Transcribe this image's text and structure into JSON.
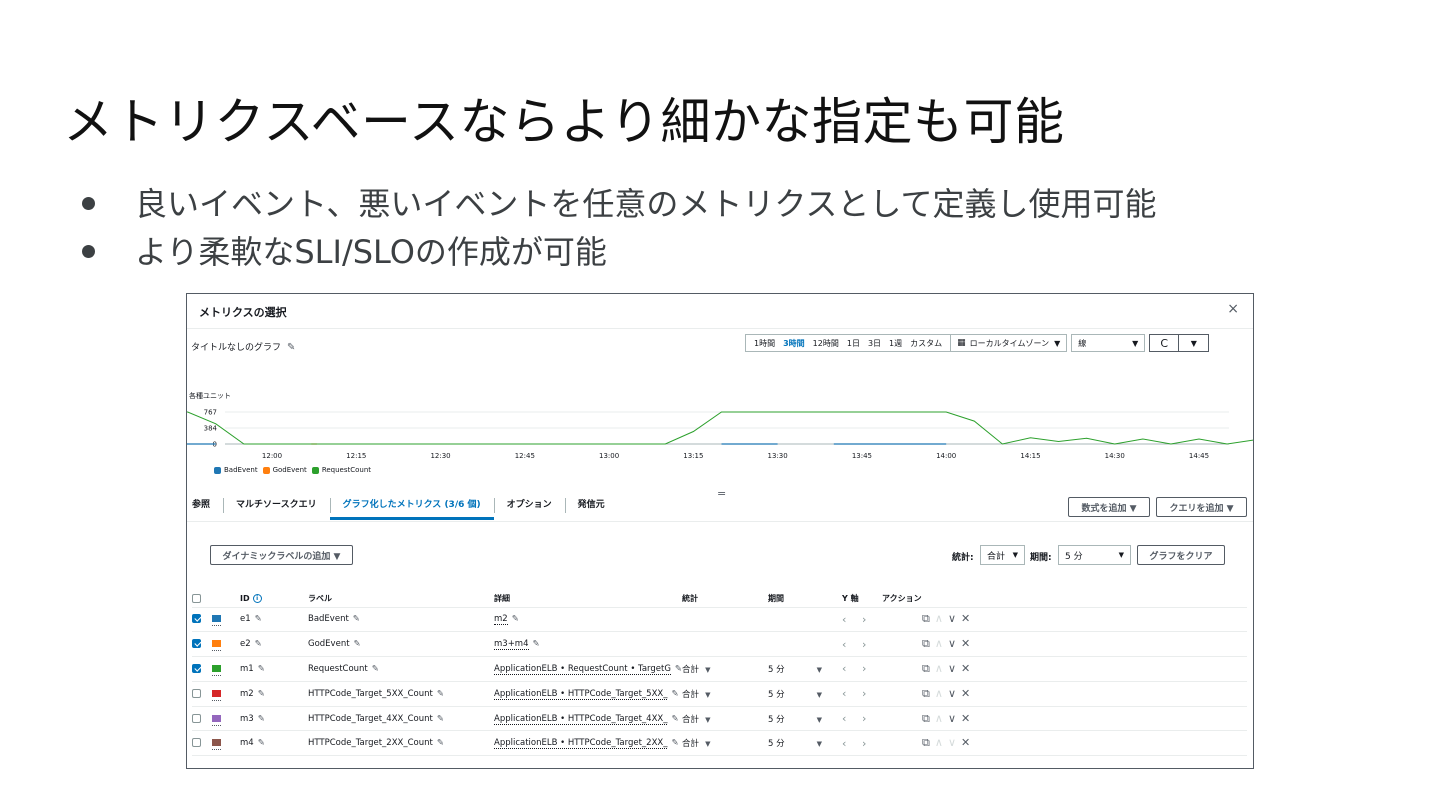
{
  "slide": {
    "title": "メトリクスベースならより細かな指定も可能",
    "bullets": [
      "良いイベント、悪いイベントを任意のメトリクスとして定義し使用可能",
      "より柔軟なSLI/SLOの作成が可能"
    ]
  },
  "panel": {
    "title": "メトリクスの選択",
    "close": "×",
    "graph_title": "タイトルなしのグラフ",
    "time_ranges": [
      {
        "label": "1時間",
        "active": false
      },
      {
        "label": "3時間",
        "active": true
      },
      {
        "label": "12時間",
        "active": false
      },
      {
        "label": "1日",
        "active": false
      },
      {
        "label": "3日",
        "active": false
      },
      {
        "label": "1週",
        "active": false
      },
      {
        "label": "カスタム",
        "active": false
      }
    ],
    "timezone": "ローカルタイムゾーン",
    "chart_type": "線",
    "dropdown_arrow": "▼",
    "refresh": "C"
  },
  "chart_data": {
    "type": "line",
    "ylabel": "各種ユニット",
    "yticks": [
      "767",
      "384",
      "0"
    ],
    "ylim": [
      0,
      767
    ],
    "xticks": [
      "12:00",
      "12:15",
      "12:30",
      "12:45",
      "13:00",
      "13:15",
      "13:30",
      "13:45",
      "14:00",
      "14:15",
      "14:30",
      "14:45"
    ],
    "x_range_minutes": [
      700,
      890
    ],
    "series": [
      {
        "name": "BadEvent",
        "color": "#1f77b4",
        "points": [
          [
            700,
            0
          ],
          [
            710,
            0
          ]
        ],
        "segments": [
          [
            [
              700,
              0
            ],
            [
              710,
              0
            ]
          ],
          [
            [
              800,
              0
            ],
            [
              810,
              0
            ]
          ],
          [
            [
              820,
              0
            ],
            [
              840,
              0
            ]
          ]
        ]
      },
      {
        "name": "GodEvent",
        "color": "#ff7f0e",
        "points": [
          [
            727,
            0
          ],
          [
            728,
            0
          ]
        ],
        "segments": [
          [
            [
              727,
              0
            ],
            [
              728,
              0
            ]
          ]
        ]
      },
      {
        "name": "RequestCount",
        "color": "#2ca02c",
        "points": [
          [
            700,
            767
          ],
          [
            705,
            767
          ],
          [
            710,
            484
          ],
          [
            715,
            0
          ],
          [
            790,
            0
          ],
          [
            795,
            300
          ],
          [
            800,
            767
          ],
          [
            840,
            767
          ],
          [
            845,
            550
          ],
          [
            850,
            0
          ],
          [
            855,
            150
          ],
          [
            860,
            60
          ],
          [
            865,
            140
          ],
          [
            870,
            0
          ],
          [
            875,
            120
          ],
          [
            880,
            0
          ],
          [
            885,
            120
          ],
          [
            890,
            0
          ],
          [
            895,
            100
          ],
          [
            900,
            0
          ],
          [
            905,
            80
          ],
          [
            910,
            0
          ],
          [
            915,
            280
          ],
          [
            920,
            0
          ]
        ]
      }
    ],
    "legend": "bottom-left",
    "grid": true
  },
  "tabs": [
    {
      "label": "参照",
      "active": false
    },
    {
      "label": "マルチソースクエリ",
      "active": false
    },
    {
      "label": "グラフ化したメトリクス (3/6 個)",
      "active": true
    },
    {
      "label": "オプション",
      "active": false
    },
    {
      "label": "発信元",
      "active": false
    }
  ],
  "drag_handle": "=",
  "buttons": {
    "add_math": "数式を追加 ▼",
    "add_query": "クエリを追加 ▼",
    "dynamic_label": "ダイナミックラベルの追加 ▼",
    "clear_graph": "グラフをクリア"
  },
  "controls": {
    "stat_label": "統計:",
    "stat_value": "合計",
    "period_label": "期間:",
    "period_value": "5 分"
  },
  "table": {
    "headers": [
      "ID",
      "ラベル",
      "詳細",
      "統計",
      "期間",
      "Y 軸",
      "アクション"
    ],
    "rows": [
      {
        "checked": true,
        "color": "#1f77b4",
        "id": "e1",
        "label": "BadEvent",
        "detail": "m2",
        "stat": "",
        "period": ""
      },
      {
        "checked": true,
        "color": "#ff7f0e",
        "id": "e2",
        "label": "GodEvent",
        "detail": "m3+m4",
        "stat": "",
        "period": ""
      },
      {
        "checked": true,
        "color": "#2ca02c",
        "id": "m1",
        "label": "RequestCount",
        "detail": "ApplicationELB • RequestCount • TargetG",
        "stat": "合計",
        "period": "5 分"
      },
      {
        "checked": false,
        "color": "#d62728",
        "id": "m2",
        "label": "HTTPCode_Target_5XX_Count",
        "detail": "ApplicationELB • HTTPCode_Target_5XX_",
        "stat": "合計",
        "period": "5 分"
      },
      {
        "checked": false,
        "color": "#9467bd",
        "id": "m3",
        "label": "HTTPCode_Target_4XX_Count",
        "detail": "ApplicationELB • HTTPCode_Target_4XX_",
        "stat": "合計",
        "period": "5 分"
      },
      {
        "checked": false,
        "color": "#8c564b",
        "id": "m4",
        "label": "HTTPCode_Target_2XX_Count",
        "detail": "ApplicationELB • HTTPCode_Target_2XX_",
        "stat": "合計",
        "period": "5 分"
      }
    ]
  }
}
